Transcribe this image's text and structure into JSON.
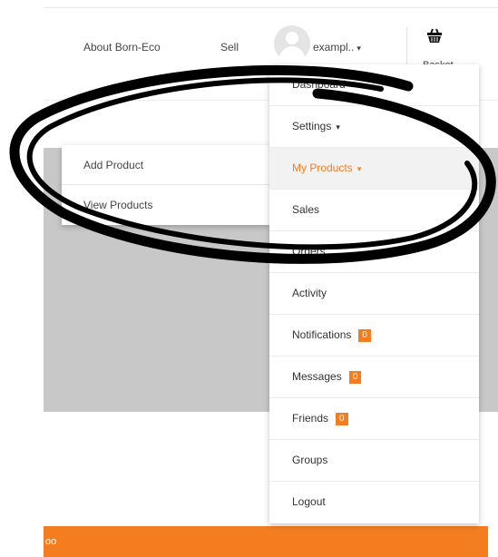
{
  "header": {
    "nav": [
      {
        "label": "About Born-Eco"
      },
      {
        "label": "Sell"
      }
    ],
    "user": {
      "name": "exampl..",
      "caret": "▾"
    },
    "basket_label": "Basket"
  },
  "dropdown": {
    "items": [
      {
        "label": "Dashboard"
      },
      {
        "label": "Settings",
        "caret": "▾"
      },
      {
        "label": "My Products",
        "caret": "▾",
        "active": true
      },
      {
        "label": "Sales"
      },
      {
        "label": "Orders"
      },
      {
        "label": "Activity"
      },
      {
        "label": "Notifications",
        "badge": "0"
      },
      {
        "label": "Messages",
        "badge": "0"
      },
      {
        "label": "Friends",
        "badge": "0"
      },
      {
        "label": "Groups"
      },
      {
        "label": "Logout"
      }
    ]
  },
  "submenu": {
    "items": [
      {
        "label": "Add Product"
      },
      {
        "label": "View Products"
      }
    ]
  },
  "footer_bar": {
    "text": "oo"
  },
  "colors": {
    "accent": "#f47d20",
    "hero": "#c8c8c8",
    "annotation": "#000000"
  }
}
